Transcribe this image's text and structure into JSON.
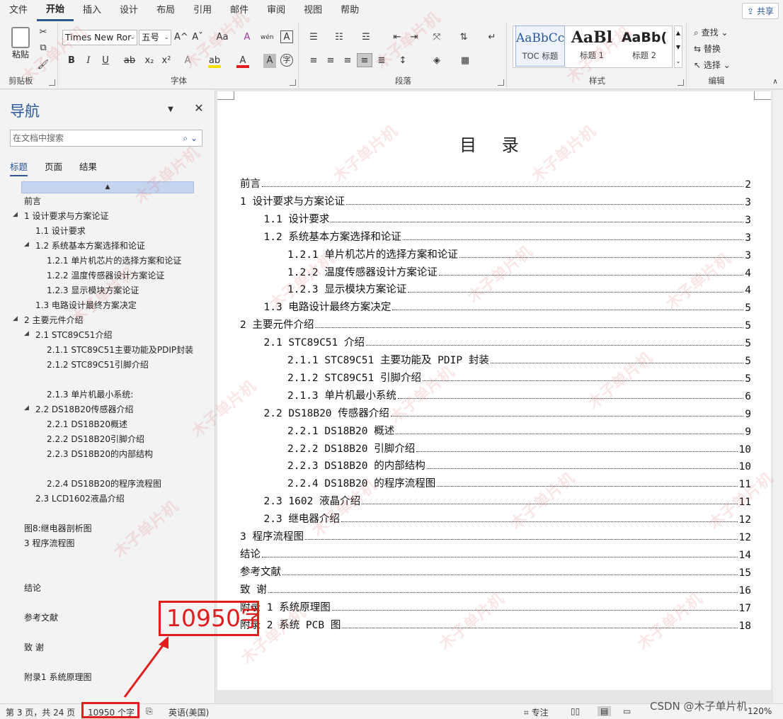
{
  "ribbon_tabs": [
    "文件",
    "开始",
    "插入",
    "设计",
    "布局",
    "引用",
    "邮件",
    "审阅",
    "视图",
    "帮助"
  ],
  "active_tab": "开始",
  "share_label": "共享",
  "clipboard": {
    "paste_label": "粘贴",
    "group_label": "剪贴板"
  },
  "font": {
    "name": "Times New Ror",
    "size": "五号",
    "group_label": "字体",
    "bold": "B",
    "italic": "I",
    "underline": "U",
    "strike": "ab",
    "sub": "x₂",
    "sup": "x²",
    "grow": "A^",
    "shrink": "Aˇ",
    "case": "Aa",
    "clear": "A",
    "phonetic": "wén",
    "border": "A",
    "effects": "A",
    "highlight": "ab",
    "color": "A",
    "shade": "A",
    "enclose": "字"
  },
  "paragraph": {
    "group_label": "段落"
  },
  "styles": {
    "group_label": "样式",
    "items": [
      {
        "preview": "AaBbCc",
        "name": "TOC 标题"
      },
      {
        "preview": "AaBl",
        "name": "标题 1"
      },
      {
        "preview": "AaBb(",
        "name": "标题 2"
      }
    ]
  },
  "editing": {
    "group_label": "编辑",
    "find": "查找",
    "replace": "替换",
    "select": "选择"
  },
  "nav": {
    "title": "导航",
    "search_placeholder": "在文档中搜索",
    "tabs": [
      "标题",
      "页面",
      "结果"
    ],
    "items": [
      {
        "label": "前言",
        "level": 0,
        "arrow": false,
        "gap": 0
      },
      {
        "label": "1 设计要求与方案论证",
        "level": 0,
        "arrow": true,
        "gap": 0
      },
      {
        "label": "1.1 设计要求",
        "level": 1,
        "arrow": false,
        "gap": 0
      },
      {
        "label": "1.2 系统基本方案选择和论证",
        "level": 1,
        "arrow": true,
        "gap": 0
      },
      {
        "label": "1.2.1 单片机芯片的选择方案和论证",
        "level": 2,
        "arrow": false,
        "gap": 0
      },
      {
        "label": "1.2.2 温度传感器设计方案论证",
        "level": 2,
        "arrow": false,
        "gap": 0
      },
      {
        "label": "1.2.3 显示模块方案论证",
        "level": 2,
        "arrow": false,
        "gap": 0
      },
      {
        "label": "1.3 电路设计最终方案决定",
        "level": 1,
        "arrow": false,
        "gap": 0
      },
      {
        "label": "2 主要元件介绍",
        "level": 0,
        "arrow": true,
        "gap": 0
      },
      {
        "label": "2.1 STC89C51介绍",
        "level": 1,
        "arrow": true,
        "gap": 0
      },
      {
        "label": "2.1.1 STC89C51主要功能及PDIP封装",
        "level": 2,
        "arrow": false,
        "gap": 0
      },
      {
        "label": "2.1.2 STC89C51引脚介绍",
        "level": 2,
        "arrow": false,
        "gap": 0
      },
      {
        "label": "2.1.3 单片机最小系统:",
        "level": 2,
        "arrow": false,
        "gap": 1
      },
      {
        "label": "2.2 DS18B20传感器介绍",
        "level": 1,
        "arrow": true,
        "gap": 0
      },
      {
        "label": "2.2.1 DS18B20概述",
        "level": 2,
        "arrow": false,
        "gap": 0
      },
      {
        "label": "2.2.2 DS18B20引脚介绍",
        "level": 2,
        "arrow": false,
        "gap": 0
      },
      {
        "label": "2.2.3 DS18B20的内部结构",
        "level": 2,
        "arrow": false,
        "gap": 0
      },
      {
        "label": "2.2.4 DS18B20的程序流程图",
        "level": 2,
        "arrow": false,
        "gap": 1
      },
      {
        "label": "2.3 LCD1602液晶介绍",
        "level": 1,
        "arrow": false,
        "gap": 0
      },
      {
        "label": "图8:继电器剖析图",
        "level": 0,
        "arrow": false,
        "gap": 1
      },
      {
        "label": "3 程序流程图",
        "level": 0,
        "arrow": false,
        "gap": 0
      },
      {
        "label": "结论",
        "level": 0,
        "arrow": false,
        "gap": 2
      },
      {
        "label": "参考文献",
        "level": 0,
        "arrow": false,
        "gap": 1
      },
      {
        "label": "致 谢",
        "level": 0,
        "arrow": false,
        "gap": 1
      },
      {
        "label": "附录1 系统原理图",
        "level": 0,
        "arrow": false,
        "gap": 1
      }
    ]
  },
  "document": {
    "toc_title": "目 录",
    "entries": [
      {
        "text": "前言",
        "page": "2",
        "level": 0
      },
      {
        "text": "1 设计要求与方案论证",
        "page": "3",
        "level": 0
      },
      {
        "text": "1.1 设计要求",
        "page": "3",
        "level": 1
      },
      {
        "text": "1.2 系统基本方案选择和论证",
        "page": "3",
        "level": 1
      },
      {
        "text": "1.2.1 单片机芯片的选择方案和论证",
        "page": "3",
        "level": 2
      },
      {
        "text": "1.2.2 温度传感器设计方案论证",
        "page": "4",
        "level": 2
      },
      {
        "text": "1.2.3 显示模块方案论证",
        "page": "4",
        "level": 2
      },
      {
        "text": "1.3 电路设计最终方案决定",
        "page": "5",
        "level": 1
      },
      {
        "text": "2 主要元件介绍",
        "page": "5",
        "level": 0
      },
      {
        "text": "2.1 STC89C51 介绍",
        "page": "5",
        "level": 1
      },
      {
        "text": "2.1.1 STC89C51 主要功能及 PDIP 封装",
        "page": "5",
        "level": 2
      },
      {
        "text": "2.1.2 STC89C51 引脚介绍",
        "page": "5",
        "level": 2
      },
      {
        "text": "2.1.3 单片机最小系统",
        "page": "6",
        "level": 2
      },
      {
        "text": "2.2 DS18B20 传感器介绍",
        "page": "9",
        "level": 1
      },
      {
        "text": "2.2.1 DS18B20 概述",
        "page": "9",
        "level": 2
      },
      {
        "text": "2.2.2 DS18B20 引脚介绍",
        "page": "10",
        "level": 2
      },
      {
        "text": "2.2.3 DS18B20 的内部结构",
        "page": "10",
        "level": 2
      },
      {
        "text": "2.2.4 DS18B20 的程序流程图",
        "page": "11",
        "level": 2
      },
      {
        "text": "2.3 1602 液晶介绍",
        "page": "11",
        "level": 1
      },
      {
        "text": "2.3 继电器介绍",
        "page": "12",
        "level": 1
      },
      {
        "text": "3 程序流程图",
        "page": "12",
        "level": 0
      },
      {
        "text": "结论",
        "page": "14",
        "level": 0
      },
      {
        "text": "参考文献",
        "page": "15",
        "level": 0
      },
      {
        "text": "致 谢",
        "page": "16",
        "level": 0
      },
      {
        "text": "附录 1 系统原理图",
        "page": "17",
        "level": 0
      },
      {
        "text": "附录 2 系统 PCB 图",
        "page": "18",
        "level": 0
      }
    ]
  },
  "status": {
    "page": "第 3 页，共 24 页",
    "words": "10950 个字",
    "lang": "英语(美国)",
    "focus": "专注",
    "zoom": "120%"
  },
  "annotation": {
    "callout_text": "10950字",
    "color": "#e01e1e"
  },
  "watermark": "木子单片机",
  "csdn_credit": "CSDN @木子单片机",
  "colors": {
    "accent": "#2b579a",
    "annotation_red": "#e01e1e"
  }
}
